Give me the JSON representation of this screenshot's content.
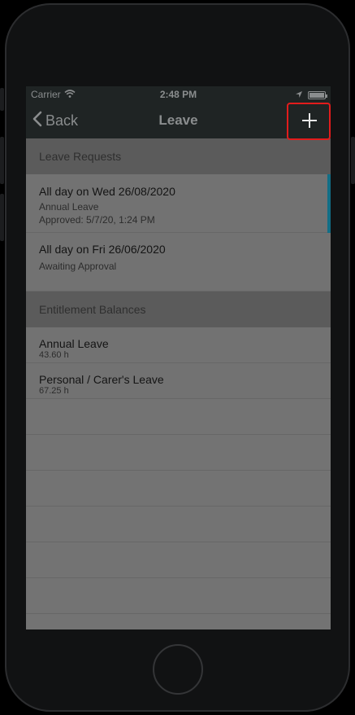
{
  "status_bar": {
    "carrier": "Carrier",
    "time": "2:48 PM"
  },
  "nav": {
    "back_label": "Back",
    "title": "Leave"
  },
  "leave_requests": {
    "header": "Leave Requests",
    "items": [
      {
        "title": "All day on Wed 26/08/2020",
        "subtitle": "Annual Leave",
        "detail": "Approved: 5/7/20, 1:24 PM"
      },
      {
        "title": "All day on Fri 26/06/2020",
        "subtitle": "Awaiting Approval"
      }
    ]
  },
  "entitlement_balances": {
    "header": "Entitlement Balances",
    "items": [
      {
        "title": "Annual Leave",
        "value": "43.60 h"
      },
      {
        "title": "Personal / Carer's Leave",
        "value": "67.25 h"
      }
    ]
  },
  "colors": {
    "accent_bar": "#126e86",
    "highlight": "#e21c1c"
  },
  "icons": [
    "wifi-icon",
    "location-arrow-icon",
    "battery-icon",
    "chevron-left-icon",
    "plus-icon"
  ]
}
